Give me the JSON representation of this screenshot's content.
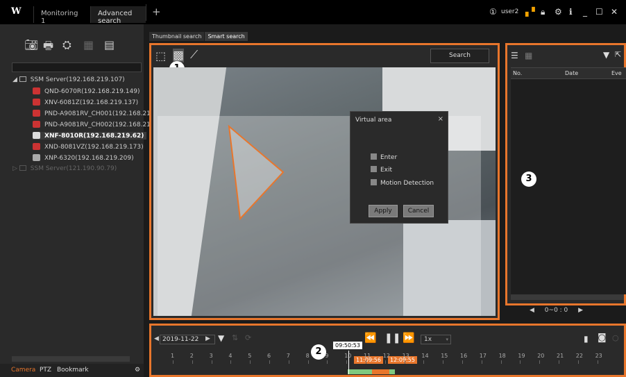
{
  "topbar": {
    "logo": "W",
    "tabs": [
      "Monitoring 1",
      "Advanced search"
    ],
    "add": "+",
    "user": "user2"
  },
  "left": {
    "tree": [
      {
        "label": "SSM Server(192.168.219.107)",
        "type": "server"
      },
      {
        "label": "QND-6070R(192.168.219.149)",
        "type": "cam"
      },
      {
        "label": "XNV-6081Z(192.168.219.137)",
        "type": "cam"
      },
      {
        "label": "PND-A9081RV_CH001(192.168.219.",
        "type": "cam"
      },
      {
        "label": "PND-A9081RV_CH002(192.168.219.",
        "type": "cam"
      },
      {
        "label": "XNF-8010R(192.168.219.62)",
        "type": "cam-bold"
      },
      {
        "label": "XND-8081VZ(192.168.219.173)",
        "type": "cam"
      },
      {
        "label": "XNP-6320(192.168.219.209)",
        "type": "cam"
      },
      {
        "label": "SSM Server(121.190.90.79)",
        "type": "server-dim"
      }
    ],
    "bottom_tabs": [
      "Camera",
      "PTZ",
      "Bookmark"
    ]
  },
  "subtabs": [
    "Thumbnail search",
    "Smart search"
  ],
  "video": {
    "search_label": "Search",
    "marker1": "1"
  },
  "dialog": {
    "title": "Virtual area",
    "close": "×",
    "options": [
      "Enter",
      "Exit",
      "Motion Detection"
    ],
    "apply": "Apply",
    "cancel": "Cancel"
  },
  "results": {
    "columns": [
      "No.",
      "Date",
      "Eve"
    ],
    "marker3": "3",
    "pager": "0~0 : 0"
  },
  "timeline": {
    "date": "2019-11-22",
    "speed": "1x",
    "cursor_time": "09:50:53",
    "range_start": "11:09:56",
    "range_end": "12:09:55",
    "marker2": "2",
    "ticks": [
      "1",
      "2",
      "3",
      "4",
      "5",
      "6",
      "7",
      "8",
      "9",
      "10",
      "11",
      "12",
      "13",
      "14",
      "15",
      "16",
      "17",
      "18",
      "19",
      "20",
      "21",
      "22",
      "23"
    ]
  },
  "colors": {
    "accent": "#e8762c",
    "record_green": "#7fc97f",
    "range_orange": "#e8762c"
  }
}
